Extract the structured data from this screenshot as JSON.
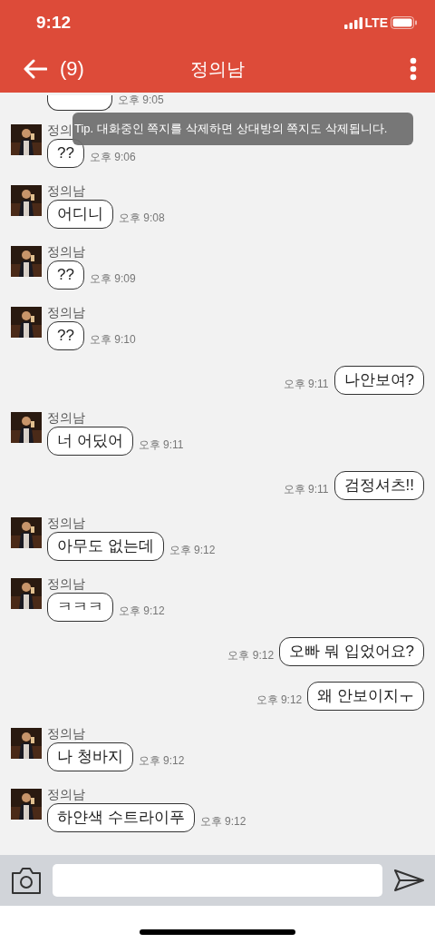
{
  "status_bar": {
    "time": "9:12",
    "network": "LTE"
  },
  "header": {
    "count": "(9)",
    "title": "정의남"
  },
  "tip": "Tip. 대화중인 쪽지를 삭제하면 상대방의 쪽지도 삭제됩니다.",
  "messages": [
    {
      "kind": "cut",
      "time": "오후 9:05"
    },
    {
      "kind": "received",
      "name": "정의",
      "text": "??",
      "time": "오후 9:06"
    },
    {
      "kind": "received",
      "name": "정의남",
      "text": "어디니",
      "time": "오후 9:08"
    },
    {
      "kind": "received",
      "name": "정의남",
      "text": "??",
      "time": "오후 9:09"
    },
    {
      "kind": "received",
      "name": "정의남",
      "text": "??",
      "time": "오후 9:10"
    },
    {
      "kind": "sent",
      "text": "나안보여?",
      "time": "오후 9:11"
    },
    {
      "kind": "received",
      "name": "정의남",
      "text": "너 어딨어",
      "time": "오후 9:11"
    },
    {
      "kind": "sent",
      "text": "검정셔츠!!",
      "time": "오후 9:11"
    },
    {
      "kind": "received",
      "name": "정의남",
      "text": "아무도 없는데",
      "time": "오후 9:12"
    },
    {
      "kind": "received",
      "name": "정의남",
      "text": "ㅋㅋㅋ",
      "time": "오후 9:12"
    },
    {
      "kind": "sent",
      "text": "오빠 뭐 입었어요?",
      "time": "오후 9:12"
    },
    {
      "kind": "sent",
      "text": "왜 안보이지ㅜ",
      "time": "오후 9:12"
    },
    {
      "kind": "received",
      "name": "정의남",
      "text": "나 청바지",
      "time": "오후 9:12"
    },
    {
      "kind": "received",
      "name": "정의남",
      "text": "하얀색 수트라이푸",
      "time": "오후 9:12"
    }
  ]
}
